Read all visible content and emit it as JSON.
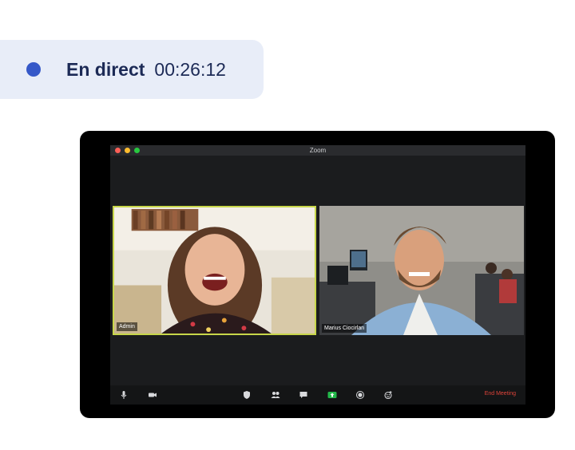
{
  "status": {
    "label": "En direct",
    "elapsed": "00:26:12",
    "dot_color": "#3558c8",
    "text_color": "#1c2a56"
  },
  "window": {
    "title": "Zoom",
    "traffic_lights": [
      "#fd5f57",
      "#febc2e",
      "#28c840"
    ]
  },
  "participants": [
    {
      "name": "Admin",
      "active_speaker": true,
      "highlight_color": "#c7d64a"
    },
    {
      "name": "Marius Ciocirlan",
      "active_speaker": false
    }
  ],
  "toolbar": {
    "icons": [
      "microphone-icon",
      "video-camera-icon",
      "security-shield-icon",
      "participants-icon",
      "chat-icon",
      "share-screen-icon",
      "record-icon",
      "reactions-icon"
    ],
    "share_color": "#23b84a",
    "end_label": "End Meeting",
    "end_color": "#e0443a"
  }
}
